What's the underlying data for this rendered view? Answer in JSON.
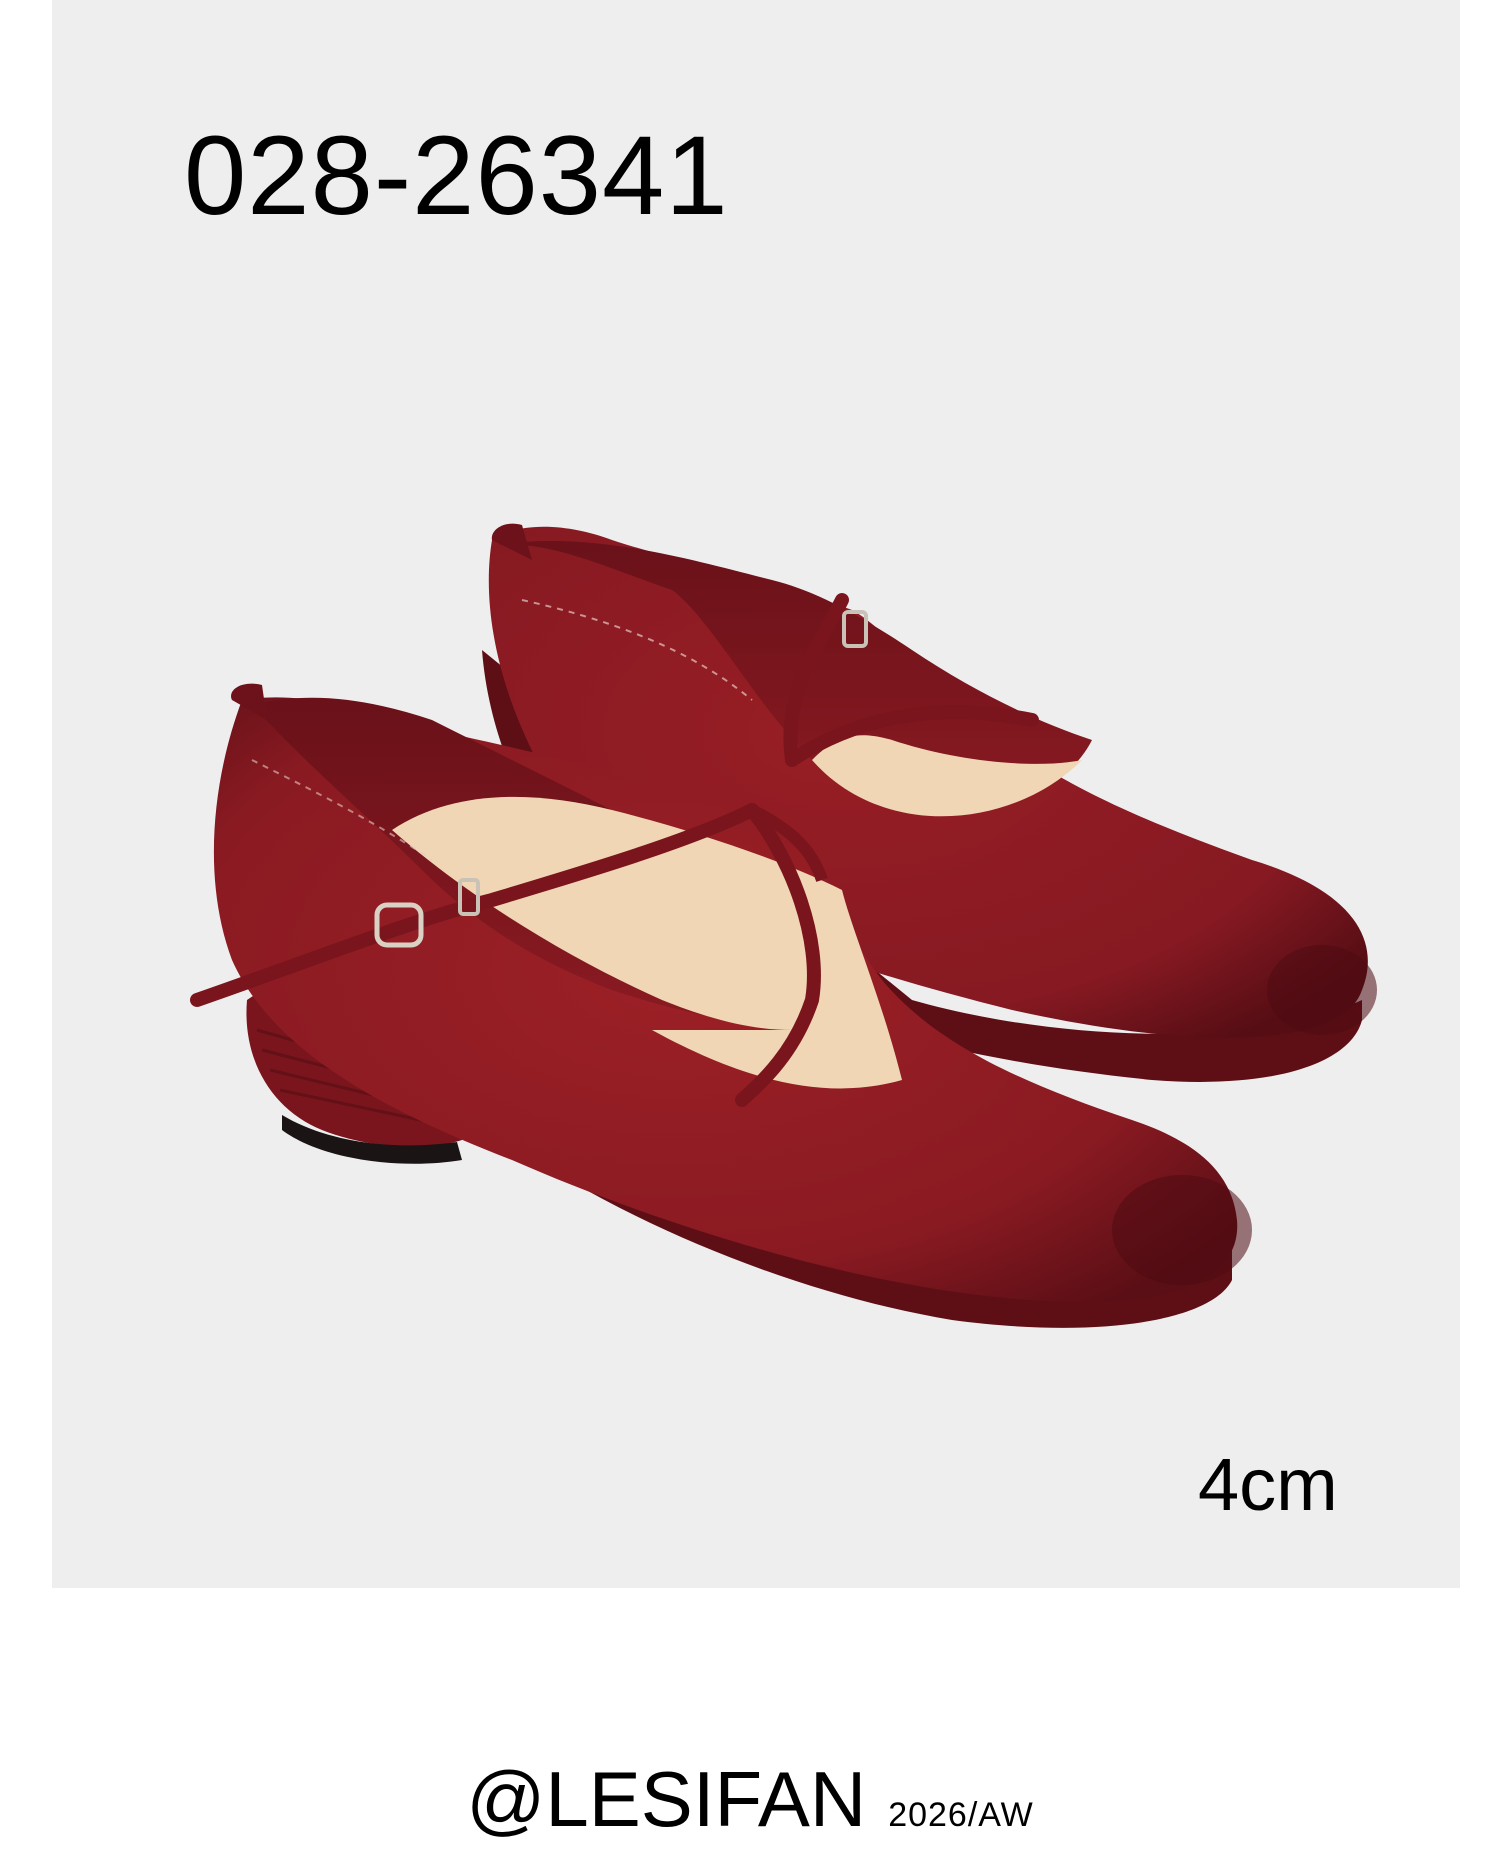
{
  "product": {
    "sku": "028-26341",
    "heel_height": "4cm"
  },
  "footer": {
    "brand": "@LESIFAN",
    "season": "2026/AW"
  },
  "colors": {
    "panel": "#eeeeee",
    "suede": "#8e1a22",
    "suede_dark": "#5e0f16",
    "insole": "#f0d6b4"
  }
}
